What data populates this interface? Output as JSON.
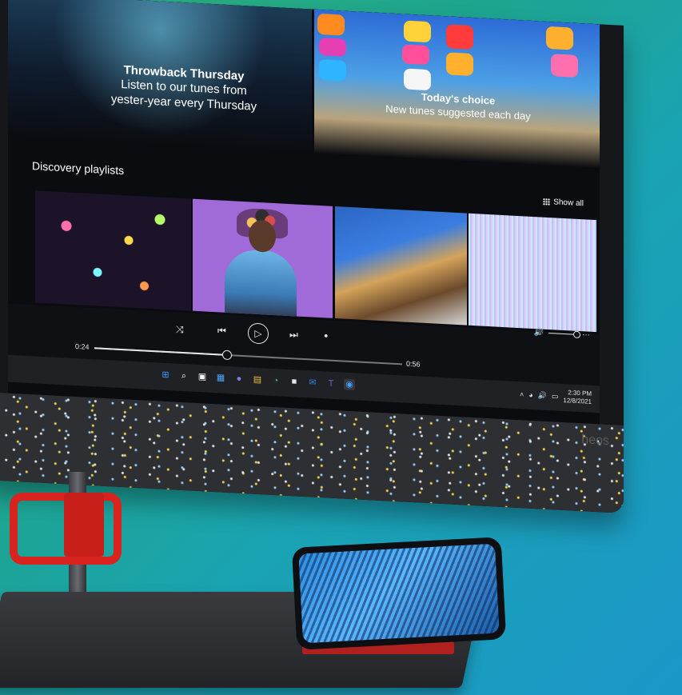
{
  "hero_left": {
    "title": "Throwback Thursday",
    "line1": "Listen to our tunes from",
    "line2": "yester-year every Thursday"
  },
  "hero_right": {
    "title": "Today's choice",
    "subtitle": "New tunes suggested each day"
  },
  "discovery": {
    "title": "Discovery playlists",
    "show_all": "Show all"
  },
  "player": {
    "elapsed": "0:24",
    "duration": "0:56",
    "progress": 0.43,
    "icons": {
      "shuffle": "⤨",
      "prev": "⏮",
      "play": "▷",
      "next": "⏭",
      "repeat": "●",
      "volume": "🔊",
      "more": "···"
    }
  },
  "taskbar": {
    "time": "2:30 PM",
    "date": "12/8/2021",
    "icons": {
      "start": "⊞",
      "search": "⌕",
      "task_view": "▣",
      "widgets": "▦",
      "chat": "●",
      "explorer": "▤",
      "edge": "◔",
      "store": "■",
      "outlook": "✉",
      "teams": "T",
      "active_app": "◉"
    },
    "tray_icons": {
      "chevron": "˄",
      "wifi": "◕",
      "volume": "🔊",
      "battery": "▭"
    }
  },
  "brand": "heos"
}
